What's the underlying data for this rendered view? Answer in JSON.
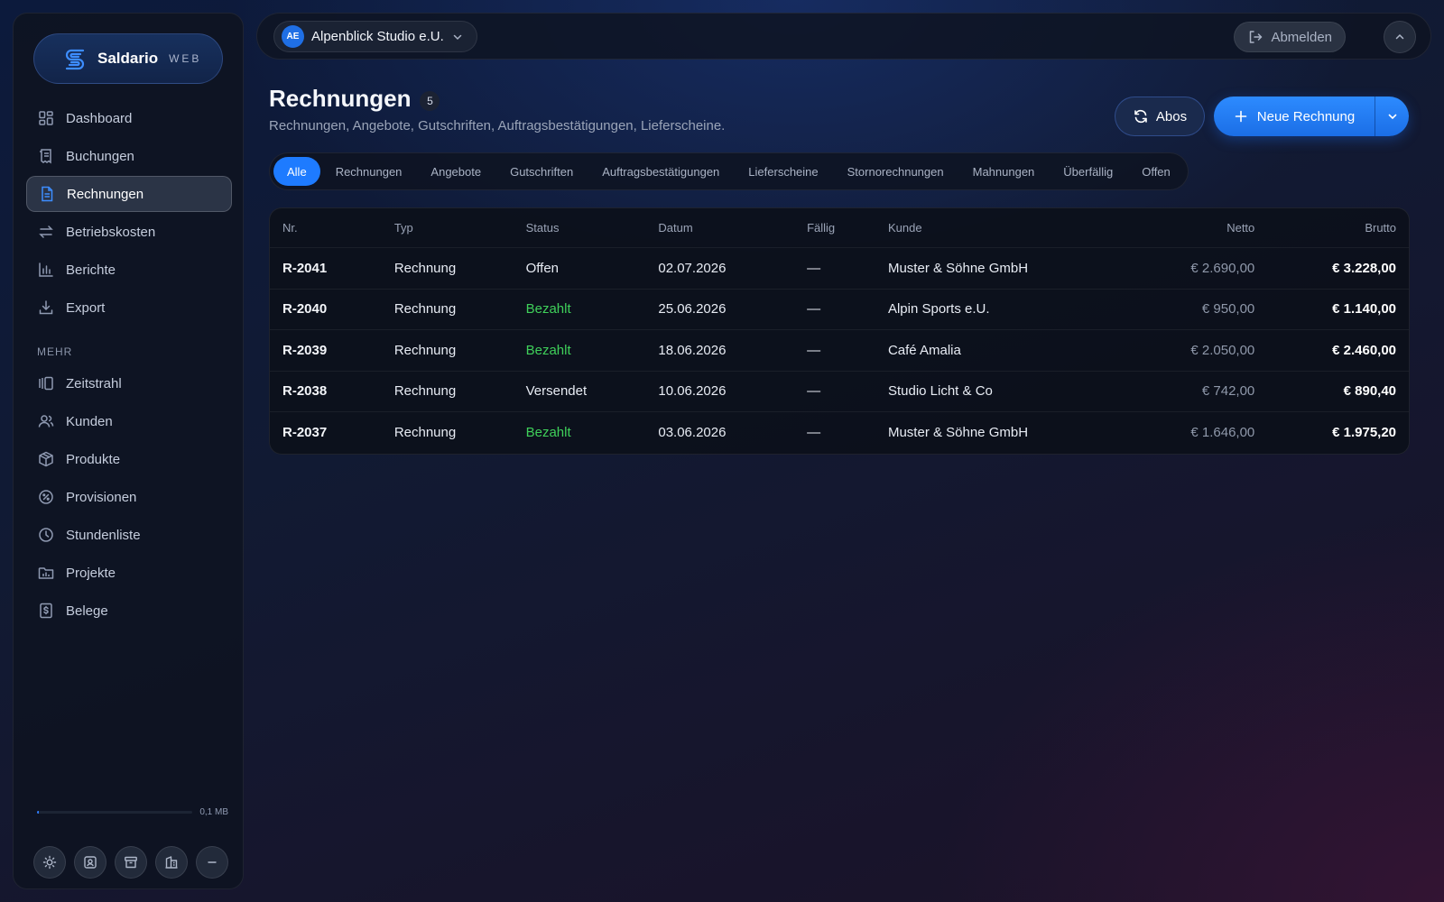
{
  "brand": {
    "name": "Saldario",
    "sub": "WEB"
  },
  "sidebar": {
    "items": [
      {
        "label": "Dashboard",
        "icon": "dashboard-icon"
      },
      {
        "label": "Buchungen",
        "icon": "receipt-icon"
      },
      {
        "label": "Rechnungen",
        "icon": "document-icon",
        "active": true
      },
      {
        "label": "Betriebskosten",
        "icon": "arrows-repeat-icon"
      },
      {
        "label": "Berichte",
        "icon": "bar-chart-icon"
      },
      {
        "label": "Export",
        "icon": "download-icon"
      }
    ],
    "more_label": "MEHR",
    "more_items": [
      {
        "label": "Zeitstrahl",
        "icon": "timeline-icon"
      },
      {
        "label": "Kunden",
        "icon": "users-icon"
      },
      {
        "label": "Produkte",
        "icon": "box-icon"
      },
      {
        "label": "Provisionen",
        "icon": "percent-badge-icon"
      },
      {
        "label": "Stundenliste",
        "icon": "clock-icon"
      },
      {
        "label": "Projekte",
        "icon": "folder-chart-icon"
      },
      {
        "label": "Belege",
        "icon": "dollar-receipt-icon"
      }
    ],
    "storage": {
      "text": "0,1 MB",
      "fraction": 0.01
    },
    "bottom_icons": [
      "sun-icon",
      "contact-card-icon",
      "archive-icon",
      "building-icon",
      "minus-icon"
    ]
  },
  "topbar": {
    "org_initials": "AE",
    "org_name": "Alpenblick Studio e.U.",
    "logout_label": "Abmelden"
  },
  "header": {
    "title": "Rechnungen",
    "count": "5",
    "subtitle": "Rechnungen, Angebote, Gutschriften, Auftragsbestätigungen, Lieferscheine.",
    "abos_label": "Abos",
    "new_label": "Neue Rechnung"
  },
  "tabs": [
    "Alle",
    "Rechnungen",
    "Angebote",
    "Gutschriften",
    "Auftragsbestätigungen",
    "Lieferscheine",
    "Stornorechnungen",
    "Mahnungen",
    "Überfällig",
    "Offen"
  ],
  "table": {
    "columns": {
      "nr": "Nr.",
      "typ": "Typ",
      "status": "Status",
      "datum": "Datum",
      "faellig": "Fällig",
      "kunde": "Kunde",
      "netto": "Netto",
      "brutto": "Brutto"
    },
    "rows": [
      {
        "nr": "R-2041",
        "typ": "Rechnung",
        "status": "Offen",
        "datum": "02.07.2026",
        "faellig": "—",
        "kunde": "Muster & Söhne GmbH",
        "netto": "€ 2.690,00",
        "brutto": "€ 3.228,00"
      },
      {
        "nr": "R-2040",
        "typ": "Rechnung",
        "status": "Bezahlt",
        "datum": "25.06.2026",
        "faellig": "—",
        "kunde": "Alpin Sports e.U.",
        "netto": "€ 950,00",
        "brutto": "€ 1.140,00"
      },
      {
        "nr": "R-2039",
        "typ": "Rechnung",
        "status": "Bezahlt",
        "datum": "18.06.2026",
        "faellig": "—",
        "kunde": "Café Amalia",
        "netto": "€ 2.050,00",
        "brutto": "€ 2.460,00"
      },
      {
        "nr": "R-2038",
        "typ": "Rechnung",
        "status": "Versendet",
        "datum": "10.06.2026",
        "faellig": "—",
        "kunde": "Studio Licht & Co",
        "netto": "€ 742,00",
        "brutto": "€ 890,40"
      },
      {
        "nr": "R-2037",
        "typ": "Rechnung",
        "status": "Bezahlt",
        "datum": "03.06.2026",
        "faellig": "—",
        "kunde": "Muster & Söhne GmbH",
        "netto": "€ 1.646,00",
        "brutto": "€ 1.975,20"
      }
    ]
  },
  "colors": {
    "accent": "#1e7bff",
    "paid": "#3fd05a"
  }
}
